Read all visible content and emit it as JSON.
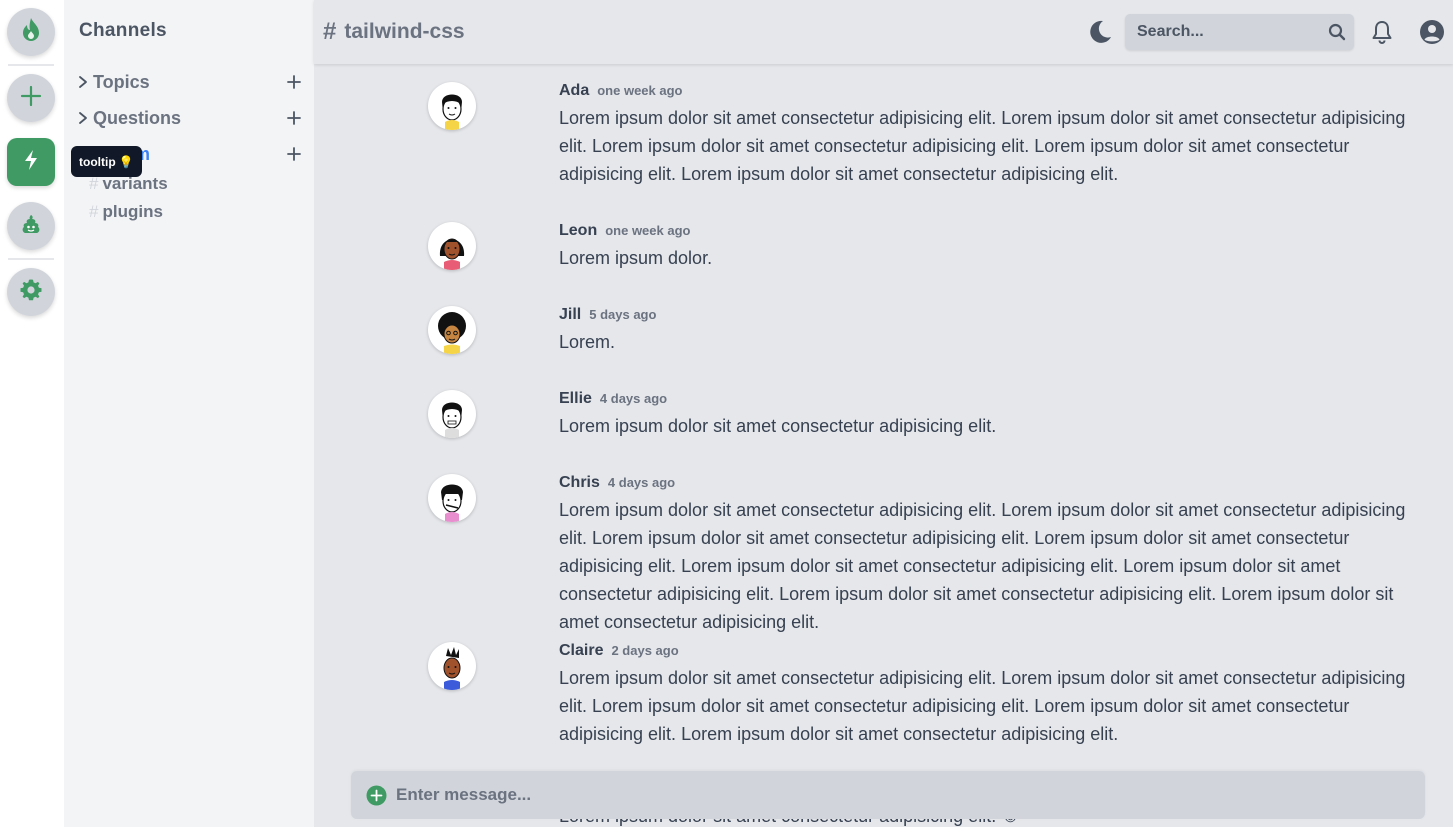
{
  "rail": {
    "tooltip": "tooltip",
    "tooltip_emoji": "💡",
    "buttons": [
      {
        "icon": "fire-icon"
      },
      {
        "icon": "plus-icon"
      },
      {
        "icon": "bolt-icon",
        "active": true
      },
      {
        "icon": "poo-icon"
      },
      {
        "icon": "gear-icon"
      }
    ],
    "accent": "#3f9a63"
  },
  "sidebar": {
    "title": "Channels",
    "sections": [
      {
        "label": "Topics"
      },
      {
        "label": "Questions"
      },
      {
        "label": "om"
      }
    ],
    "channels": [
      {
        "label": "variants"
      },
      {
        "label": "plugins"
      }
    ]
  },
  "header": {
    "channel": "tailwind-css",
    "search_placeholder": "Search..."
  },
  "messages": [
    {
      "name": "Ada",
      "time": "one week ago",
      "text": "Lorem ipsum dolor sit amet consectetur adipisicing elit. Lorem ipsum dolor sit amet consectetur adipisicing elit. Lorem ipsum dolor sit amet consectetur adipisicing elit. Lorem ipsum dolor sit amet consectetur adipisicing elit. Lorem ipsum dolor sit amet consectetur adipisicing elit."
    },
    {
      "name": "Leon",
      "time": "one week ago",
      "text": "Lorem ipsum dolor."
    },
    {
      "name": "Jill",
      "time": "5 days ago",
      "text": "Lorem."
    },
    {
      "name": "Ellie",
      "time": "4 days ago",
      "text": "Lorem ipsum dolor sit amet consectetur adipisicing elit."
    },
    {
      "name": "Chris",
      "time": "4 days ago",
      "text": "Lorem ipsum dolor sit amet consectetur adipisicing elit. Lorem ipsum dolor sit amet consectetur adipisicing elit. Lorem ipsum dolor sit amet consectetur adipisicing elit. Lorem ipsum dolor sit amet consectetur adipisicing elit. Lorem ipsum dolor sit amet consectetur adipisicing elit. Lorem ipsum dolor sit amet consectetur adipisicing elit. Lorem ipsum dolor sit amet consectetur adipisicing elit. Lorem ipsum dolor sit amet consectetur adipisicing elit."
    },
    {
      "name": "Claire",
      "time": "2 days ago",
      "text": "Lorem ipsum dolor sit amet consectetur adipisicing elit. Lorem ipsum dolor sit amet consectetur adipisicing elit. Lorem ipsum dolor sit amet consectetur adipisicing elit. Lorem ipsum dolor sit amet consectetur adipisicing elit. Lorem ipsum dolor sit amet consectetur adipisicing elit."
    }
  ],
  "peek_text": "Lorem ipsum dolor sit amet consectetur adipisicing elit. ☺",
  "composer": {
    "placeholder": "Enter message..."
  }
}
